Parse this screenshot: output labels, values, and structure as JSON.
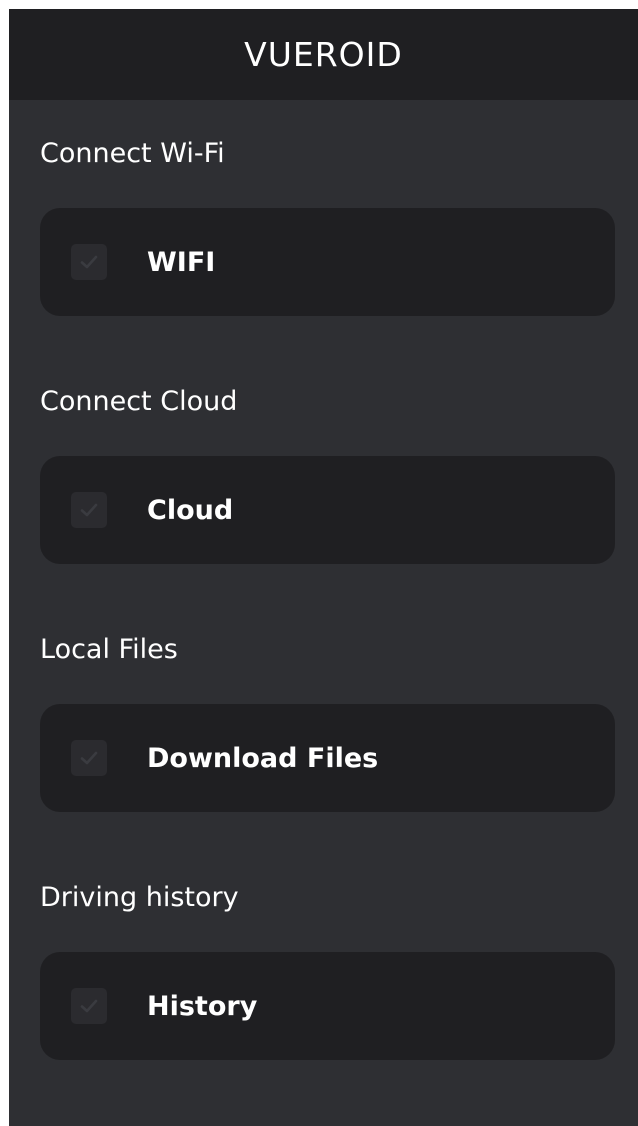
{
  "header": {
    "title": "VUEROID"
  },
  "sections": [
    {
      "title": "Connect Wi-Fi",
      "item_label": "WIFI"
    },
    {
      "title": "Connect Cloud",
      "item_label": "Cloud"
    },
    {
      "title": "Local Files",
      "item_label": "Download Files"
    },
    {
      "title": "Driving history",
      "item_label": "History"
    }
  ],
  "icons": {
    "checkbox": "check-icon"
  },
  "colors": {
    "background": "#2e2f33",
    "header": "#1f1f22",
    "card": "#1f1f22",
    "text": "#ffffff",
    "checkbox": "#2b2b2f"
  }
}
